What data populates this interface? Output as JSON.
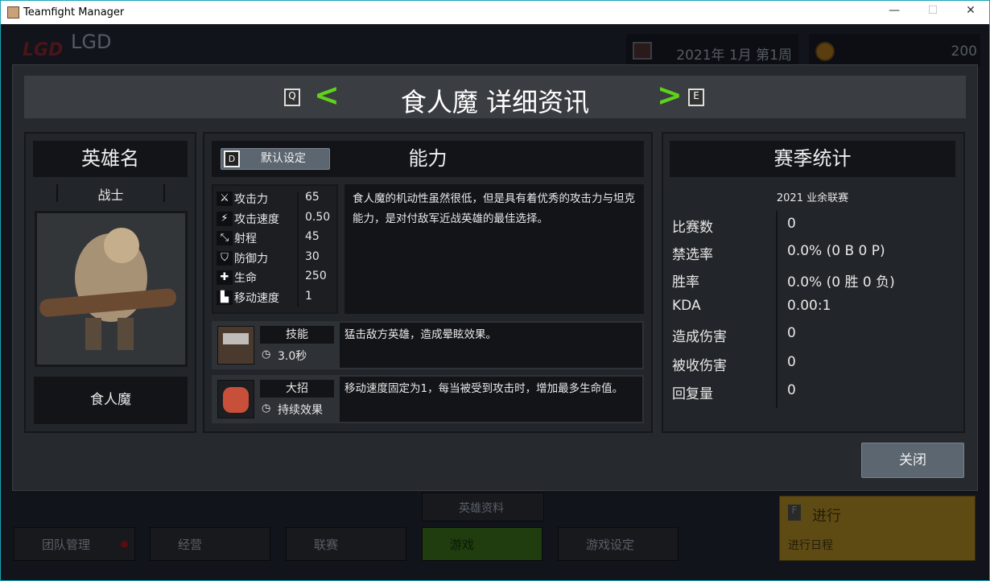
{
  "window": {
    "title": "Teamfight Manager",
    "minimize": "—",
    "maximize": "☐",
    "close": "✕"
  },
  "background": {
    "team_name": "LGD",
    "date": "2021年 1月 第1周",
    "gold": "200",
    "nav": [
      {
        "label": "团队管理",
        "icon": "shield-icon"
      },
      {
        "label": "经营",
        "icon": "document-icon"
      },
      {
        "label": "联赛",
        "icon": "trophy-icon"
      },
      {
        "label": "游戏",
        "icon": "gamepad-icon",
        "active": true
      },
      {
        "label": "游戏设定",
        "icon": "gear-icon"
      }
    ],
    "hero_info": "英雄资料",
    "proceed": {
      "key": "F",
      "label": "进行",
      "sub": "进行日程"
    }
  },
  "modal": {
    "title": "食人魔 详细资讯",
    "prev_key": "Q",
    "next_key": "E",
    "hero": {
      "header": "英雄名",
      "role": "战士",
      "name": "食人魔"
    },
    "ability": {
      "header": "能力",
      "default_key": "D",
      "default_label": "默认设定",
      "stats": [
        {
          "label": "攻击力",
          "value": "65",
          "icon": "sword-icon"
        },
        {
          "label": "攻击速度",
          "value": "0.50",
          "icon": "attack-speed-icon"
        },
        {
          "label": "射程",
          "value": "45",
          "icon": "range-icon"
        },
        {
          "label": "防御力",
          "value": "30",
          "icon": "shield-icon"
        },
        {
          "label": "生命",
          "value": "250",
          "icon": "health-cross-icon"
        },
        {
          "label": "移动速度",
          "value": "1",
          "icon": "boot-icon"
        }
      ],
      "description": "食人魔的机动性虽然很低，但是具有着优秀的攻击力与坦克能力，是对付敌军近战英雄的最佳选择。",
      "skill": {
        "label": "技能",
        "cooldown": "3.0秒",
        "description": "猛击敌方英雄，造成晕眩效果。"
      },
      "ultimate": {
        "label": "大招",
        "cooldown": "持续效果",
        "description": "移动速度固定为1，每当被受到攻击时，增加最多生命值。"
      }
    },
    "season": {
      "header": "赛季统计",
      "league": "2021 业余联赛",
      "rows": [
        {
          "label": "比赛数",
          "value": "0"
        },
        {
          "label": "禁选率",
          "value": "0.0% (0 B 0 P)"
        },
        {
          "label": "胜率",
          "value": "0.0% (0 胜 0 负)"
        },
        {
          "label": "KDA",
          "value": "0.00:1"
        },
        {
          "label": "造成伤害",
          "value": "0"
        },
        {
          "label": "被收伤害",
          "value": "0"
        },
        {
          "label": "回复量",
          "value": "0"
        }
      ]
    },
    "close": "关闭"
  },
  "colors": {
    "accent_green": "#5fd21a",
    "active_nav": "#1f3d0f",
    "proceed_bg": "#5e4b14",
    "button": "#5c6670"
  }
}
